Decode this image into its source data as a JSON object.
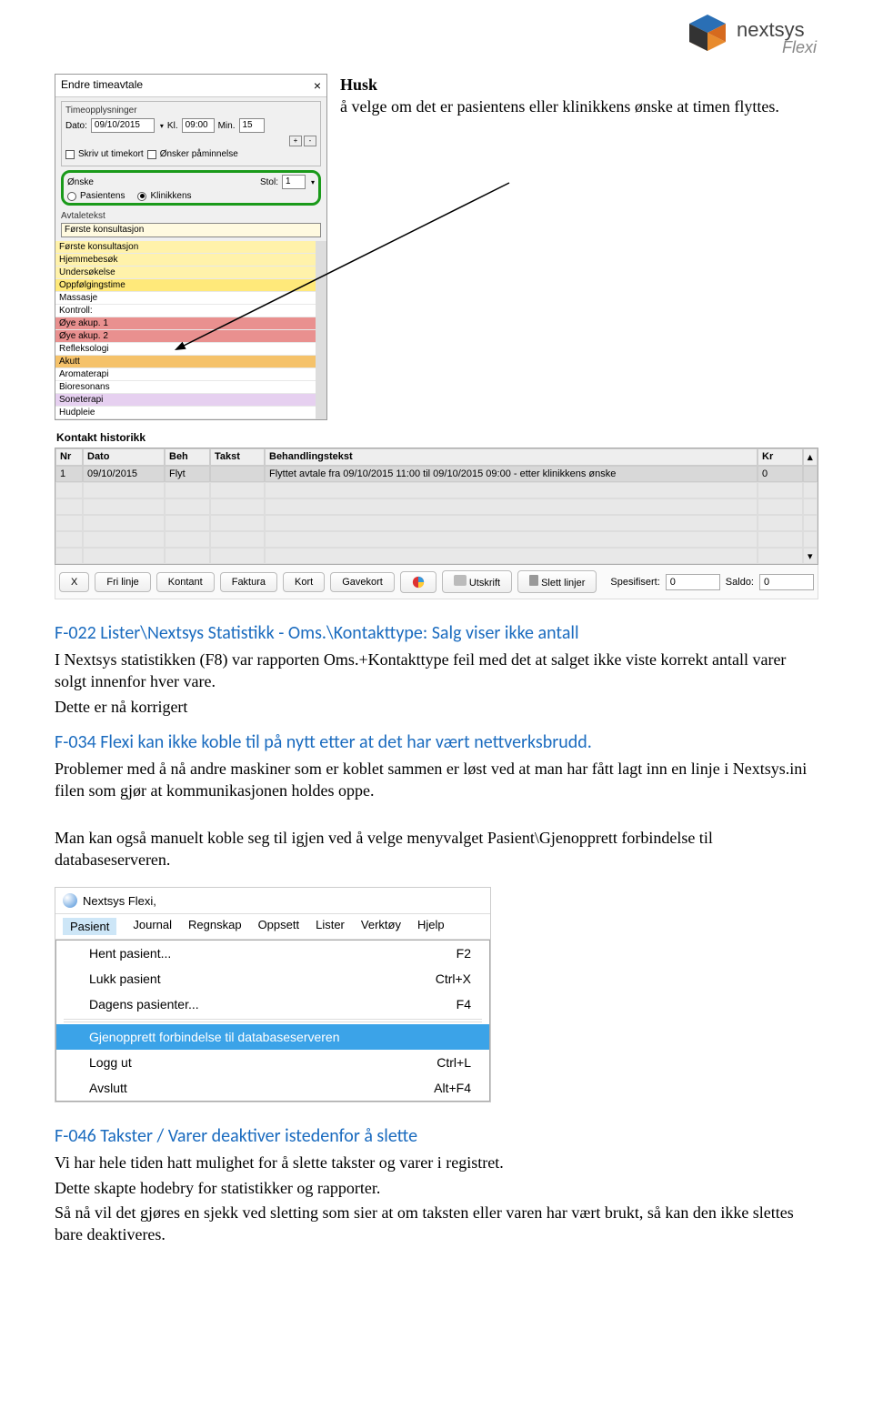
{
  "logo": {
    "brand": "nextsys",
    "sub": "Flexi"
  },
  "dialog": {
    "title": "Endre timeavtale",
    "group_time": "Timeopplysninger",
    "dato_label": "Dato:",
    "dato_value": "09/10/2015",
    "kl_label": "Kl.",
    "kl_value": "09:00",
    "min_label": "Min.",
    "min_value": "15",
    "chk_timekort": "Skriv ut timekort",
    "chk_paminnelse": "Ønsker påminnelse",
    "onske_label": "Ønske",
    "radio_pasientens": "Pasientens",
    "radio_klinikkens": "Klinikkens",
    "stol_label": "Stol:",
    "stol_value": "1",
    "group_avtale": "Avtaletekst",
    "avtale_first": "Første konsultasjon",
    "avtale_items": [
      "Første konsultasjon",
      "Hjemmebesøk",
      "Undersøkelse",
      "Oppfølgingstime",
      "Massasje",
      "Kontroll:",
      "Øye akup. 1",
      "Øye akup. 2",
      "Refleksologi",
      "Akutt",
      "Aromaterapi",
      "Bioresonans",
      "Soneterapi",
      "Hudpleie"
    ]
  },
  "instruct": {
    "l1": "Husk",
    "l2": "å velge om det er pasientens eller klinikkens ønske at timen flyttes."
  },
  "kontakt": {
    "title": "Kontakt historikk",
    "cols": {
      "nr": "Nr",
      "dato": "Dato",
      "beh": "Beh",
      "takst": "Takst",
      "tekst": "Behandlingstekst",
      "kr": "Kr"
    },
    "row": {
      "nr": "1",
      "dato": "09/10/2015",
      "beh": "Flyt",
      "takst": "",
      "tekst": "Flyttet avtale fra 09/10/2015 11:00 til 09/10/2015 09:00 - etter klinikkens ønske",
      "kr": "0"
    }
  },
  "toolbar": {
    "x": "X",
    "fri": "Fri linje",
    "kontant": "Kontant",
    "faktura": "Faktura",
    "kort": "Kort",
    "gavekort": "Gavekort",
    "utskrift": "Utskrift",
    "slett": "Slett linjer",
    "spes_label": "Spesifisert:",
    "spes_val": "0",
    "saldo_label": "Saldo:",
    "saldo_val": "0"
  },
  "f022": {
    "heading": "F-022 Lister\\Nextsys Statistikk - Oms.\\Kontakttype:  Salg viser ikke antall",
    "p1": "I Nextsys statistikken (F8) var rapporten Oms.+Kontakttype feil med det at salget ikke viste korrekt antall varer solgt innenfor hver vare.",
    "p2": "Dette er nå korrigert"
  },
  "f034": {
    "heading": "F-034 Flexi kan ikke koble til på nytt etter at det har vært nettverksbrudd.",
    "p1": "Problemer med å nå andre maskiner som er koblet sammen er løst ved at man har fått lagt inn en linje i Nextsys.ini filen som gjør at kommunikasjonen holdes oppe.",
    "p2": "Man kan også manuelt koble seg til igjen ved å velge menyvalget Pasient\\Gjenopprett forbindelse til databaseserveren."
  },
  "menu": {
    "app_title": "Nextsys Flexi,",
    "bar": [
      "Pasient",
      "Journal",
      "Regnskap",
      "Oppsett",
      "Lister",
      "Verktøy",
      "Hjelp"
    ],
    "items": [
      {
        "label": "Hent pasient...",
        "shortcut": "F2"
      },
      {
        "label": "Lukk pasient",
        "shortcut": "Ctrl+X"
      },
      {
        "label": "Dagens pasienter...",
        "shortcut": "F4"
      }
    ],
    "highlight": {
      "label": "Gjenopprett forbindelse til databaseserveren",
      "shortcut": ""
    },
    "items2": [
      {
        "label": "Logg ut",
        "shortcut": "Ctrl+L"
      },
      {
        "label": "Avslutt",
        "shortcut": "Alt+F4"
      }
    ]
  },
  "f046": {
    "heading": "F-046 Takster / Varer deaktiver istedenfor å slette",
    "p1": "Vi har hele tiden hatt mulighet for å slette takster og varer i registret.",
    "p2": "Dette skapte hodebry for statistikker og rapporter.",
    "p3": "Så nå vil det gjøres en sjekk ved sletting som sier at om taksten eller varen har vært brukt, så kan den ikke slettes bare deaktiveres."
  }
}
